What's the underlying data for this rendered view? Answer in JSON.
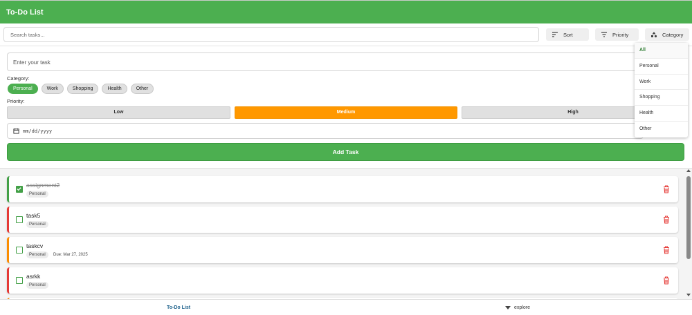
{
  "header": {
    "title": "To-Do List"
  },
  "toolbar": {
    "search_placeholder": "Search tasks...",
    "sort_label": "Sort",
    "priority_label": "Priority",
    "category_label": "Category"
  },
  "form": {
    "task_placeholder": "Enter your task",
    "category_label": "Category:",
    "categories": [
      "Personal",
      "Work",
      "Shopping",
      "Health",
      "Other"
    ],
    "selected_category": "Personal",
    "priority_label": "Priority:",
    "priorities": [
      "Low",
      "Medium",
      "High"
    ],
    "selected_priority": "Medium",
    "date_placeholder": "mm/dd/yyyy",
    "add_button": "Add Task"
  },
  "category_dropdown": {
    "options": [
      "All",
      "Personal",
      "Work",
      "Shopping",
      "Health",
      "Other"
    ],
    "selected": "All"
  },
  "tasks": [
    {
      "title": "assignment2",
      "category": "Personal",
      "done": true,
      "priority_color": "#43a047",
      "due": ""
    },
    {
      "title": "task5",
      "category": "Personal",
      "done": false,
      "priority_color": "#e53935",
      "due": ""
    },
    {
      "title": "taskcv",
      "category": "Personal",
      "done": false,
      "priority_color": "#fb8c00",
      "due": "Due: Mar 27, 2025"
    },
    {
      "title": "asrkk",
      "category": "Personal",
      "done": false,
      "priority_color": "#e53935",
      "due": ""
    }
  ],
  "bottom_nav": {
    "tab_todo": "To-Do List",
    "tab_explore": "explore"
  },
  "colors": {
    "primary": "#4caf50",
    "accent_orange": "#ff9800",
    "danger": "#e53935"
  }
}
